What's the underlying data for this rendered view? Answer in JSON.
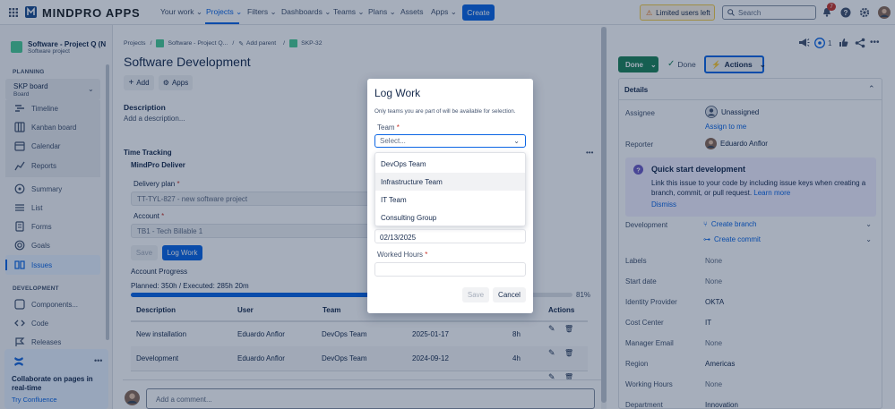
{
  "topbar": {
    "logo": "MINDPRO APPS",
    "nav": [
      "Your work",
      "Projects",
      "Filters",
      "Dashboards",
      "Teams",
      "Plans",
      "Assets",
      "Apps"
    ],
    "create": "Create",
    "limited": "Limited users left",
    "search_placeholder": "Search",
    "notif_count": "7"
  },
  "sidebar": {
    "project_name": "Software - Project Q (N",
    "project_type": "Software project",
    "planning_header": "PLANNING",
    "board_name": "SKP board",
    "board_sub": "Board",
    "items": [
      "Timeline",
      "Kanban board",
      "Calendar",
      "Reports",
      "Summary",
      "List",
      "Forms",
      "Goals",
      "Issues"
    ],
    "development_header": "DEVELOPMENT",
    "dev_items": [
      "Components...",
      "Code",
      "Releases"
    ],
    "promo_title": "Collaborate on pages in real-time",
    "promo_link": "Try Confluence"
  },
  "issue": {
    "breadcrumb": [
      "Projects",
      "Software - Project Q...",
      "Add parent",
      "SKP-32"
    ],
    "title": "Software Development",
    "add_btn": "Add",
    "apps_btn": "Apps",
    "desc_label": "Description",
    "desc_placeholder": "Add a description...",
    "time_tracking": "Time Tracking",
    "mindpro": "MindPro Deliver",
    "delivery_label": "Delivery plan",
    "delivery_value": "TT-TYL-827 - new software project",
    "account_label": "Account",
    "account_value": "TB1 - Tech Billable 1",
    "save": "Save",
    "log_work": "Log Work",
    "account_progress": "Account Progress",
    "planned": "Planned: 350h / Executed: 285h 20m",
    "progress_pct": "81%",
    "progress_value": 0.81,
    "table_headers": [
      "Description",
      "User",
      "Team",
      "Actions"
    ],
    "rows": [
      {
        "desc": "New installation",
        "user": "Eduardo Anflor",
        "team": "DevOps Team",
        "date": "2025-01-17",
        "hours": "8h"
      },
      {
        "desc": "Development",
        "user": "Eduardo Anflor",
        "team": "DevOps Team",
        "date": "2024-09-12",
        "hours": "4h"
      }
    ],
    "comment_placeholder": "Add a comment..."
  },
  "details": {
    "watch_count": "1",
    "status": "Done",
    "resolution": "Done",
    "actions": "Actions",
    "panel_title": "Details",
    "assignee_label": "Assignee",
    "assignee": "Unassigned",
    "assign_me": "Assign to me",
    "reporter_label": "Reporter",
    "reporter": "Eduardo Anflor",
    "qs_title": "Quick start development",
    "qs_text1": "Link this issue to your code by including issue keys when creating a branch, commit, or pull request.",
    "qs_learn": "Learn more",
    "qs_dismiss": "Dismiss",
    "development_label": "Development",
    "create_branch": "Create branch",
    "create_commit": "Create commit",
    "fields": [
      {
        "label": "Labels",
        "value": "None"
      },
      {
        "label": "Start date",
        "value": "None"
      },
      {
        "label": "Identity Provider",
        "value": "OKTA"
      },
      {
        "label": "Cost Center",
        "value": "IT"
      },
      {
        "label": "Manager Email",
        "value": "None"
      },
      {
        "label": "Region",
        "value": "Americas"
      },
      {
        "label": "Working Hours",
        "value": "None"
      },
      {
        "label": "Department",
        "value": "Innovation"
      }
    ]
  },
  "modal": {
    "title": "Log Work",
    "note": "Only teams you are part of will be available for selection.",
    "team_label": "Team",
    "team_placeholder": "Select...",
    "options": [
      "DevOps Team",
      "Infrastructure Team",
      "IT Team",
      "Consulting Group"
    ],
    "date_value": "02/13/2025",
    "hours_label": "Worked Hours",
    "save": "Save",
    "cancel": "Cancel"
  }
}
